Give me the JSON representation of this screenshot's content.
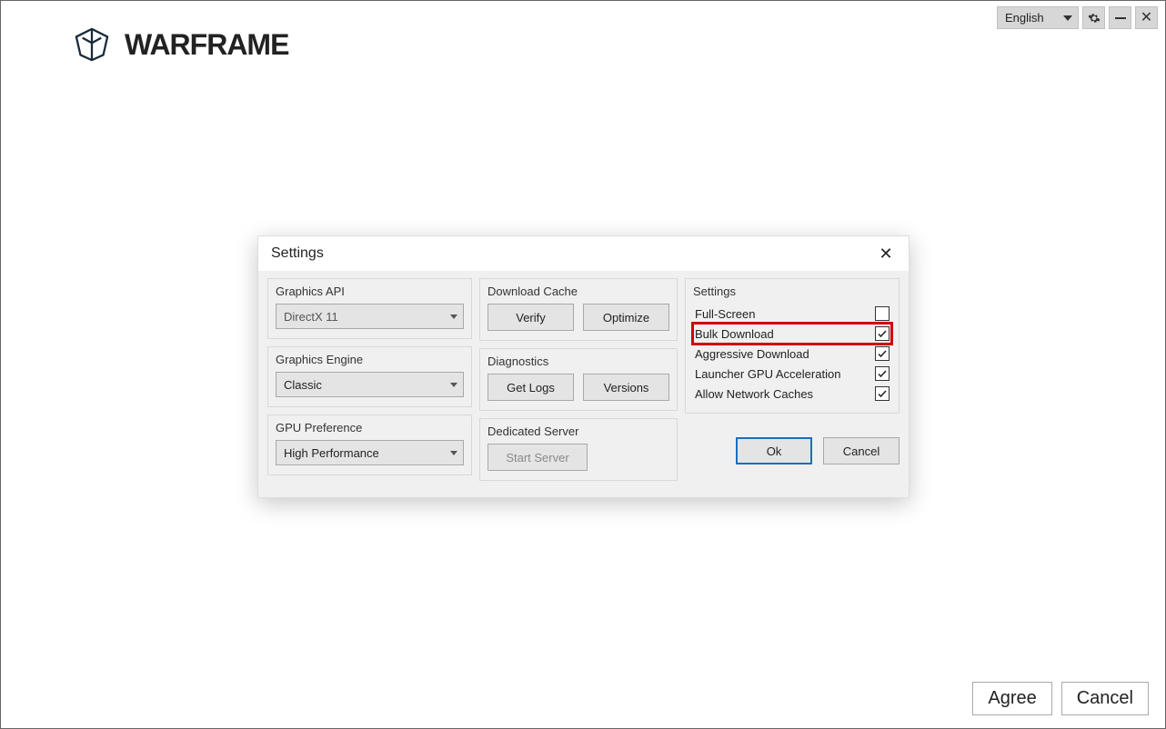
{
  "topbar": {
    "language": "English"
  },
  "logo": {
    "text": "WARFRAME"
  },
  "dialog": {
    "title": "Settings",
    "groups": {
      "graphics_api": {
        "title": "Graphics API",
        "value": "DirectX 11"
      },
      "graphics_engine": {
        "title": "Graphics Engine",
        "value": "Classic"
      },
      "gpu_preference": {
        "title": "GPU Preference",
        "value": "High Performance"
      },
      "download_cache": {
        "title": "Download Cache",
        "verify": "Verify",
        "optimize": "Optimize"
      },
      "diagnostics": {
        "title": "Diagnostics",
        "get_logs": "Get Logs",
        "versions": "Versions"
      },
      "dedicated_server": {
        "title": "Dedicated Server",
        "start": "Start Server"
      },
      "settings_checks": {
        "title": "Settings",
        "items": [
          {
            "label": "Full-Screen",
            "checked": false,
            "highlight": false
          },
          {
            "label": "Bulk Download",
            "checked": true,
            "highlight": true
          },
          {
            "label": "Aggressive Download",
            "checked": true,
            "highlight": false
          },
          {
            "label": "Launcher GPU Acceleration",
            "checked": true,
            "highlight": false
          },
          {
            "label": "Allow Network Caches",
            "checked": true,
            "highlight": false
          }
        ]
      }
    },
    "ok": "Ok",
    "cancel": "Cancel"
  },
  "bottom": {
    "agree": "Agree",
    "cancel": "Cancel"
  }
}
